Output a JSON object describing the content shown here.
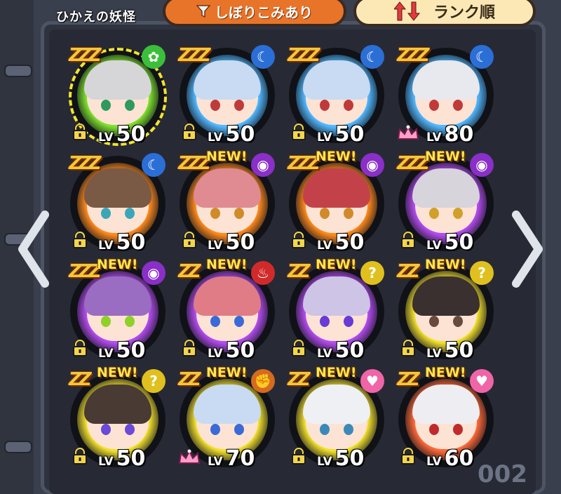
{
  "header": {
    "title": "ひかえの妖怪",
    "filter_label": "しぼりこみあり",
    "sort_label": "ランク順"
  },
  "page_number": "002",
  "level_prefix": "LV",
  "new_label": "NEW!",
  "slots": [
    {
      "zzz": "ZZZ",
      "new": false,
      "tribe": "clover-icon",
      "tribe_color": "#3bbf3b",
      "tribe_glyph": "✿",
      "aura": "#7fe12f",
      "hair": "#d6d6d8",
      "eye": "#2f9a5e",
      "badge": "lock",
      "level": "50",
      "selected": true
    },
    {
      "zzz": "ZZZ",
      "new": false,
      "tribe": "moon-icon",
      "tribe_color": "#2b6fd6",
      "tribe_glyph": "☾",
      "aura": "#52b8ff",
      "hair": "#c8dbf2",
      "eye": "#c03a3a",
      "badge": "lock",
      "level": "50",
      "selected": false
    },
    {
      "zzz": "ZZZ",
      "new": false,
      "tribe": "moon-icon",
      "tribe_color": "#2b6fd6",
      "tribe_glyph": "☾",
      "aura": "#52b8ff",
      "hair": "#c8dbf2",
      "eye": "#c03a3a",
      "badge": "lock",
      "level": "50",
      "selected": false
    },
    {
      "zzz": "ZZZ",
      "new": false,
      "tribe": "moon-icon",
      "tribe_color": "#2b6fd6",
      "tribe_glyph": "☾",
      "aura": "#52b8ff",
      "hair": "#e8e8ef",
      "eye": "#c03a3a",
      "badge": "crown",
      "level": "80",
      "selected": false
    },
    {
      "zzz": "ZZZ",
      "new": false,
      "tribe": "moon-icon",
      "tribe_color": "#2b6fd6",
      "tribe_glyph": "☾",
      "aura": "#ff8a1e",
      "hair": "#7a5a44",
      "eye": "#3aa7b8",
      "badge": "lock",
      "level": "50",
      "selected": false
    },
    {
      "zzz": "ZZZ",
      "new": true,
      "tribe": "eye-icon",
      "tribe_color": "#8a2fc7",
      "tribe_glyph": "◉",
      "aura": "#ff8a1e",
      "hair": "#e08a92",
      "eye": "#d08a2a",
      "badge": "lock",
      "level": "50",
      "selected": false
    },
    {
      "zzz": "ZZZ",
      "new": true,
      "tribe": "eye-icon",
      "tribe_color": "#8a2fc7",
      "tribe_glyph": "◉",
      "aura": "#ff8a1e",
      "hair": "#c3424a",
      "eye": "#d08a2a",
      "badge": "lock",
      "level": "50",
      "selected": false
    },
    {
      "zzz": "ZZZ",
      "new": true,
      "tribe": "eye-icon",
      "tribe_color": "#8a2fc7",
      "tribe_glyph": "◉",
      "aura": "#b44cf0",
      "hair": "#d7d4dc",
      "eye": "#d0a02a",
      "badge": "lock",
      "level": "50",
      "selected": false
    },
    {
      "zzz": "ZZZ",
      "new": true,
      "tribe": "eye-icon",
      "tribe_color": "#8a2fc7",
      "tribe_glyph": "◉",
      "aura": "#b44cf0",
      "hair": "#9a6cc2",
      "eye": "#8fd12a",
      "badge": "lock",
      "level": "50",
      "selected": false
    },
    {
      "zzz": "ZZ",
      "new": true,
      "tribe": "flame-icon",
      "tribe_color": "#d12a2a",
      "tribe_glyph": "♨",
      "aura": "#b44cf0",
      "hair": "#e07c86",
      "eye": "#3a6ad6",
      "badge": "lock",
      "level": "50",
      "selected": false
    },
    {
      "zzz": "ZZ",
      "new": true,
      "tribe": "question-icon",
      "tribe_color": "#e0c01e",
      "tribe_glyph": "?",
      "aura": "#b44cf0",
      "hair": "#cdc4e6",
      "eye": "#6a3ad6",
      "badge": "lock",
      "level": "50",
      "selected": false
    },
    {
      "zzz": "ZZ",
      "new": true,
      "tribe": "question-icon",
      "tribe_color": "#e0c01e",
      "tribe_glyph": "?",
      "aura": "#f2e02e",
      "hair": "#3a3030",
      "eye": "#6a4a3a",
      "badge": "lock",
      "level": "50",
      "selected": false
    },
    {
      "zzz": "ZZ",
      "new": true,
      "tribe": "question-icon",
      "tribe_color": "#e0c01e",
      "tribe_glyph": "?",
      "aura": "#f2e02e",
      "hair": "#4a3a34",
      "eye": "#6a4ad6",
      "badge": "lock",
      "level": "50",
      "selected": false
    },
    {
      "zzz": "ZZ",
      "new": true,
      "tribe": "fist-icon",
      "tribe_color": "#d66a1e",
      "tribe_glyph": "✊",
      "aura": "#f2e02e",
      "hair": "#c8dbf2",
      "eye": "#3a6ad6",
      "badge": "crown",
      "level": "70",
      "selected": false
    },
    {
      "zzz": "ZZ",
      "new": true,
      "tribe": "heart-icon",
      "tribe_color": "#f064a8",
      "tribe_glyph": "♥",
      "aura": "#f2e02e",
      "hair": "#eef0f4",
      "eye": "#3a8ab8",
      "badge": "lock",
      "level": "50",
      "selected": false
    },
    {
      "zzz": "ZZ",
      "new": true,
      "tribe": "heart-icon",
      "tribe_color": "#f064a8",
      "tribe_glyph": "♥",
      "aura": "#ff6a3a",
      "hair": "#eeeef2",
      "eye": "#c02a2a",
      "badge": "lock",
      "level": "60",
      "selected": false
    }
  ]
}
